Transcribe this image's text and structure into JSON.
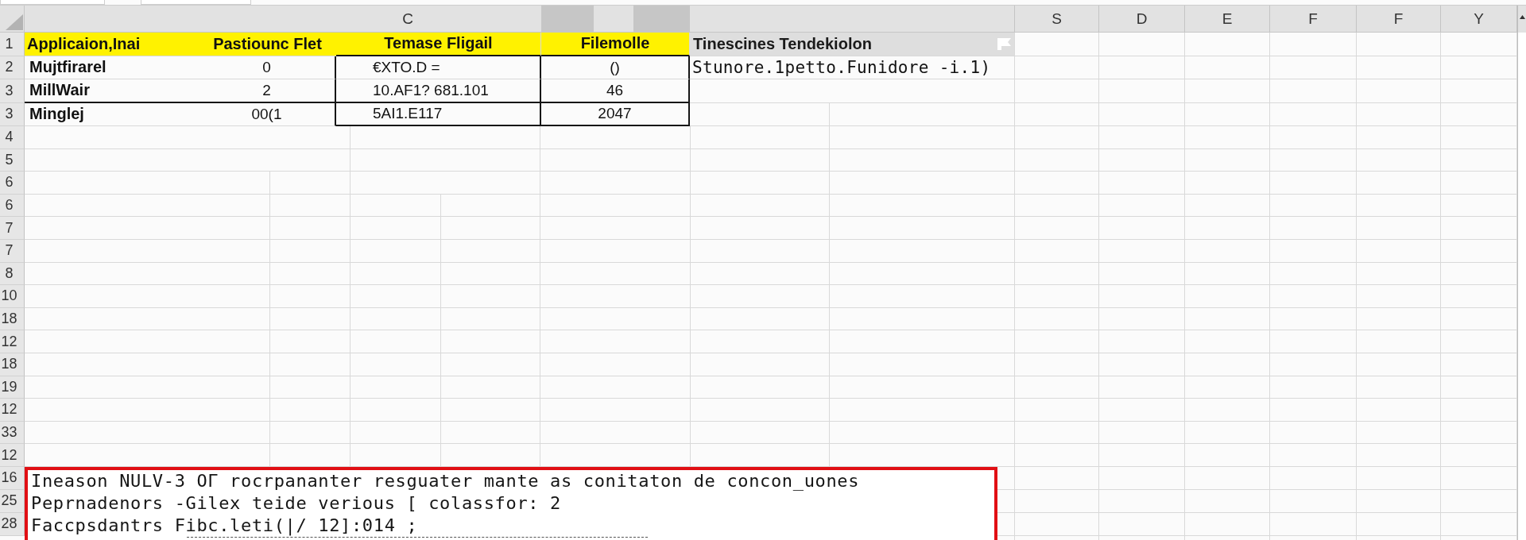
{
  "column_headers": [
    {
      "selected": false
    },
    {
      "label": "C",
      "selected": false
    },
    {
      "selected": true
    },
    {
      "selected": false
    },
    {
      "selected": true
    },
    {
      "selected": false
    },
    {
      "label": "S",
      "selected": false
    },
    {
      "label": "D",
      "selected": false
    },
    {
      "label": "E",
      "selected": false
    },
    {
      "label": "F",
      "selected": false
    },
    {
      "label": "F",
      "selected": false
    },
    {
      "label": "Y",
      "selected": false
    }
  ],
  "table_rows": [
    {
      "label": "1",
      "kind": "heading",
      "cells": [
        "Applicaion,Inai",
        "Pastiounc Flet",
        "Temase Fligail",
        "Filemolle",
        "Tinescines Tendekiolon"
      ]
    },
    {
      "label": "2",
      "kind": "data",
      "cells": [
        "Mujtfirarel",
        "0",
        "€XTO.D =",
        "()",
        "Stunore.1petto.Funidore -i.1)"
      ]
    },
    {
      "label": "3",
      "kind": "data",
      "cells": [
        "MillWair",
        "2",
        "10.AF1? 681.101",
        "46"
      ]
    },
    {
      "label": "3",
      "kind": "data",
      "cells": [
        "Minglej",
        "00(1",
        "5AI1.E117",
        "2047"
      ]
    }
  ],
  "empty_rows": [
    {
      "label": "4"
    },
    {
      "label": "5"
    },
    {
      "label": "6"
    },
    {
      "label": "6"
    },
    {
      "label": "7"
    },
    {
      "label": "7"
    },
    {
      "label": "8"
    },
    {
      "label": "10"
    },
    {
      "label": "18"
    },
    {
      "label": "12"
    },
    {
      "label": "18"
    },
    {
      "label": "19"
    },
    {
      "label": "12"
    },
    {
      "label": "33"
    },
    {
      "label": "12"
    }
  ],
  "note": {
    "rows": [
      {
        "label": "16",
        "text": "Ineason NULV-3 OΓ rocrpananter resguater mante as conitaton de concon_uones"
      },
      {
        "label": "25",
        "text": "Peprnadenors -Gilex teide verious [ colassfor: 2"
      },
      {
        "label": "28",
        "text": "Faccpsdantrs Fibc.leti(|/ 12]:014 ;"
      }
    ]
  }
}
